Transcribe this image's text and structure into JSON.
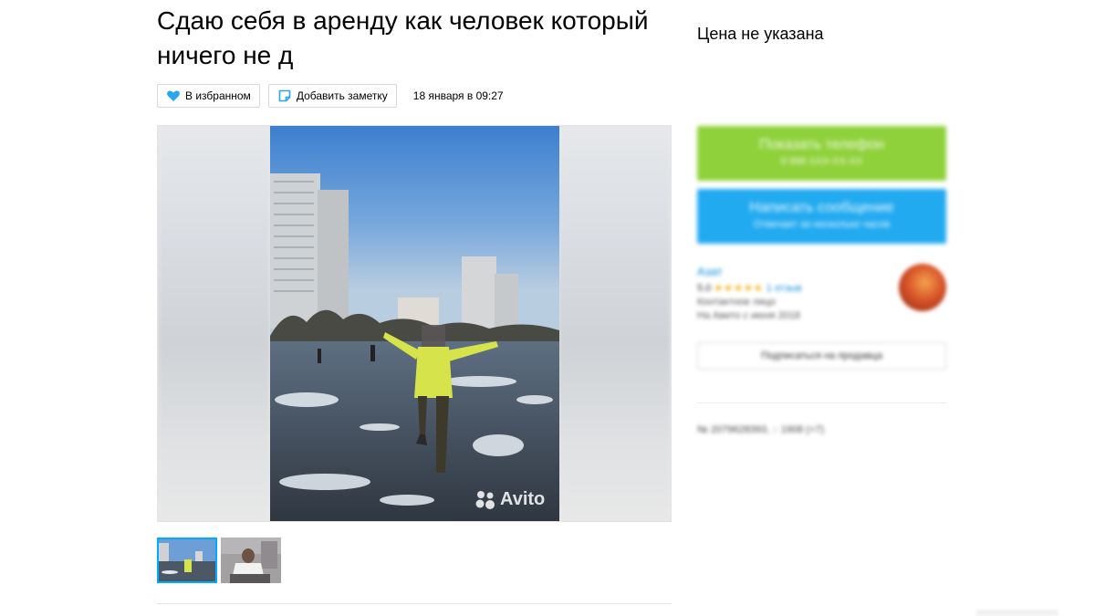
{
  "listing": {
    "title": "Сдаю себя в аренду как человек который ничего не д",
    "price": "Цена не указана",
    "date": "18 января в 09:27"
  },
  "actions": {
    "favorite_label": "В избранном",
    "note_label": "Добавить заметку"
  },
  "gallery": {
    "watermark": "Avito",
    "thumbnails": [
      "thumbnail-1",
      "thumbnail-2"
    ],
    "active_index": 0
  },
  "contact": {
    "phone_button_label": "Показать телефон",
    "phone_masked": "8 996 XXX-XX-XX",
    "message_button_label": "Написать сообщение",
    "message_button_sub": "Отвечает за несколько часов"
  },
  "seller": {
    "name": "Азат",
    "rating": "5.0",
    "stars": "★★★★★",
    "reviews": "1 отзыв",
    "type": "Контактное лицо",
    "since": "На Авито с июня 2018",
    "subscribe_label": "Подписаться на продавца"
  },
  "meta": {
    "ad_number": "№ 2079628393",
    "views": "1908 (+7)"
  },
  "colors": {
    "phone_button": "#8fd13b",
    "message_button": "#22aaf0",
    "link": "#0a8fd8",
    "active_thumb_border": "#00aaff"
  },
  "icons": {
    "favorite": "heart-icon",
    "note": "note-icon",
    "views": "eye-icon"
  }
}
